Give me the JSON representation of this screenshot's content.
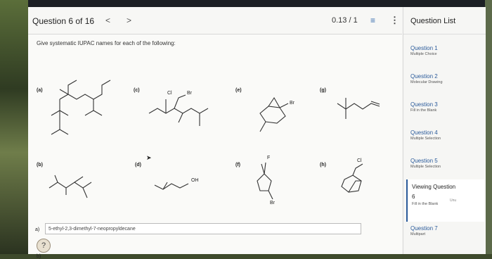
{
  "header": {
    "title": "Question 6 of 16",
    "prev": "<",
    "next": ">",
    "score": "0.13 / 1",
    "list_icon": "≡",
    "more_icon": "⋮"
  },
  "prompt": "Give systematic IUPAC names for each of the following:",
  "structures": {
    "a": "(a)",
    "b": "(b)",
    "c": "(c)",
    "d": "(d)",
    "e": "(e)",
    "f": "(f)",
    "g": "(g)",
    "h": "(h)"
  },
  "atoms": {
    "cl": "Cl",
    "br": "Br",
    "oh": "OH",
    "f": "F"
  },
  "answer": {
    "label": "a)",
    "value": "5-ethyl-2,3-dimethyl-7-neopropyldecane"
  },
  "help_icon": "?",
  "next_answer_label": "b)",
  "panel": {
    "title": "Question List",
    "questions": [
      {
        "title": "Question 1",
        "type": "Multiple Choice"
      },
      {
        "title": "Question 2",
        "type": "Molecular Drawing"
      },
      {
        "title": "Question 3",
        "type": "Fill in the Blank"
      },
      {
        "title": "Question 4",
        "type": "Multiple Selection"
      },
      {
        "title": "Question 5",
        "type": "Multiple Selection"
      }
    ],
    "viewing": {
      "title": "Viewing Question",
      "number": "6",
      "type": "Fill in the Blank"
    },
    "q7": {
      "title": "Question 7",
      "type": "Multipart"
    }
  },
  "side_tag": "Unu"
}
